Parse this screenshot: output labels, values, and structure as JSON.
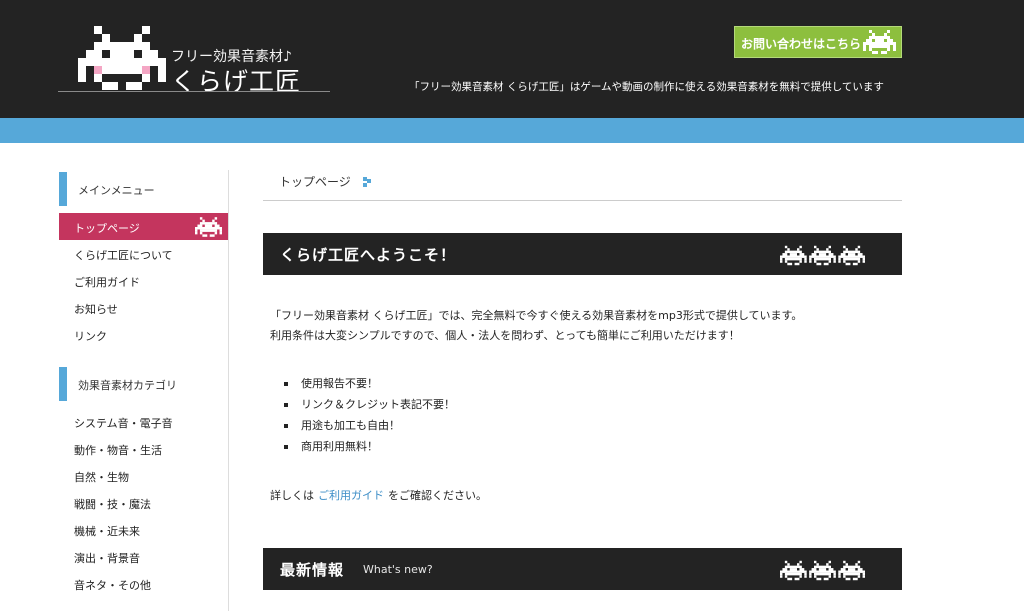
{
  "header": {
    "logo_sub": "フリー効果音素材♪",
    "logo_main": "くらげ工匠",
    "contact_label": "お問い合わせはこちら",
    "tagline": "「フリー効果音素材 くらげ工匠」はゲームや動画の制作に使える効果音素材を無料で提供しています"
  },
  "sidebar": {
    "menu_heading": "メインメニュー",
    "menu": [
      {
        "label": "トップページ",
        "active": true
      },
      {
        "label": "くらげ工匠について"
      },
      {
        "label": "ご利用ガイド"
      },
      {
        "label": "お知らせ"
      },
      {
        "label": "リンク"
      }
    ],
    "category_heading": "効果音素材カテゴリ",
    "categories": [
      {
        "label": "システム音・電子音"
      },
      {
        "label": "動作・物音・生活"
      },
      {
        "label": "自然・生物"
      },
      {
        "label": "戦闘・技・魔法"
      },
      {
        "label": "機械・近未来"
      },
      {
        "label": "演出・背景音"
      },
      {
        "label": "音ネタ・その他"
      }
    ]
  },
  "breadcrumb": "トップページ",
  "welcome": {
    "title": "くらげ工匠へようこそ！",
    "intro_line1": "「フリー効果音素材 くらげ工匠」では、完全無料で今すぐ使える効果音素材をmp3形式で提供しています。",
    "intro_line2": "利用条件は大変シンプルですので、個人・法人を問わず、とっても簡単にご利用いただけます！",
    "features": [
      "使用報告不要！",
      "リンク＆クレジット表記不要！",
      "用途も加工も自由！",
      "商用利用無料！"
    ],
    "details_prefix": "詳しくは",
    "details_link": "ご利用ガイド",
    "details_suffix": "をご確認ください。"
  },
  "news": {
    "title": "最新情報",
    "subtitle": "What's new?"
  },
  "colors": {
    "header_bg": "#232323",
    "band": "#56a8d9",
    "active_menu": "#c4355e",
    "contact_btn": "#8dbf3e",
    "link": "#3d8ec7"
  }
}
